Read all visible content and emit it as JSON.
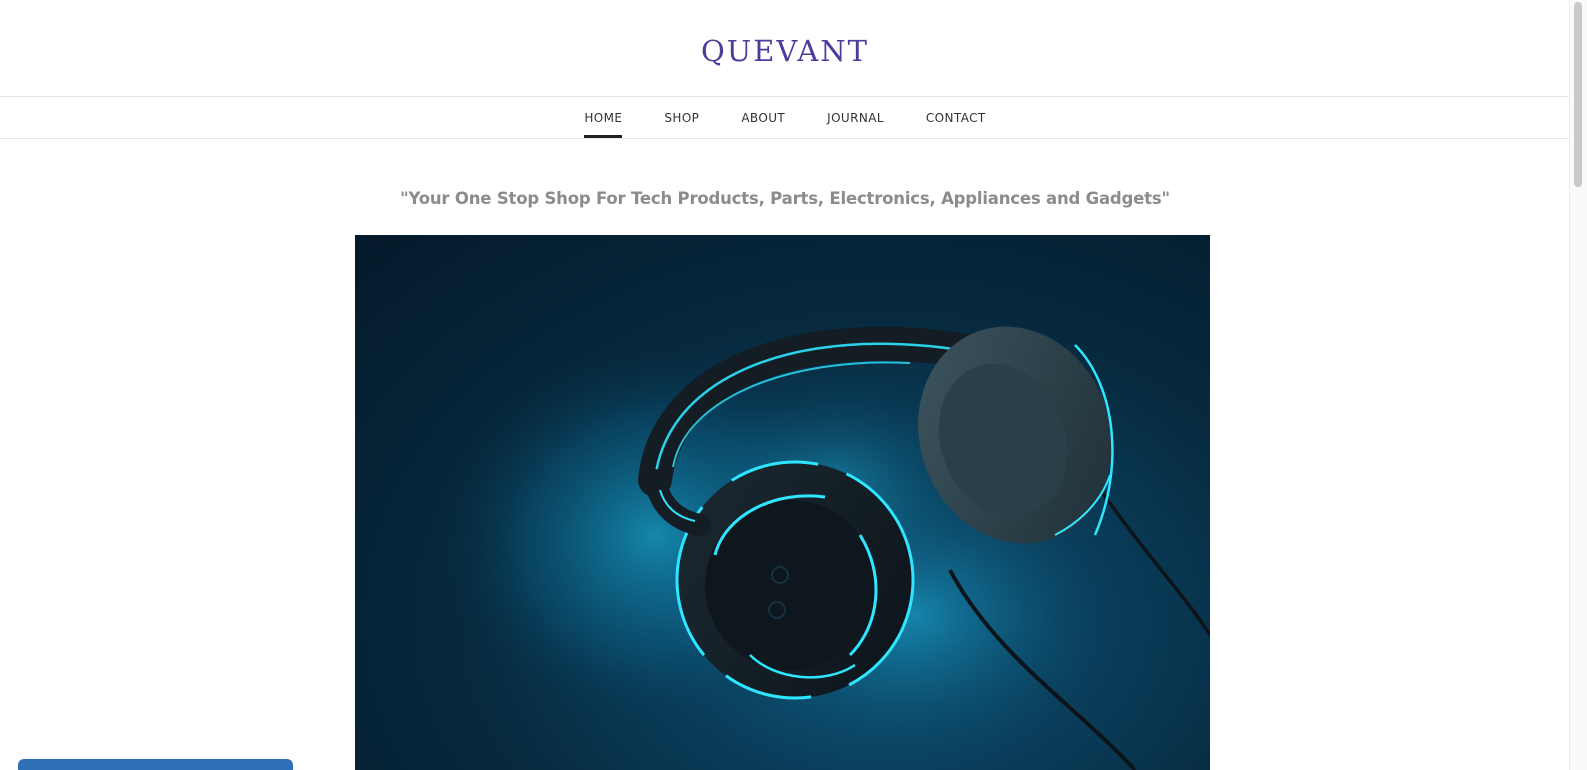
{
  "site": {
    "logo": "QUEVANT"
  },
  "nav": {
    "items": [
      {
        "label": "HOME",
        "active": true
      },
      {
        "label": "SHOP",
        "active": false
      },
      {
        "label": "ABOUT",
        "active": false
      },
      {
        "label": "JOURNAL",
        "active": false
      },
      {
        "label": "CONTACT",
        "active": false
      }
    ]
  },
  "main": {
    "tagline": "\"Your One Stop Shop For Tech Products, Parts, Electronics, Appliances and Gadgets\"",
    "hero_image": "headphones-neon-image"
  },
  "colors": {
    "logo": "#4a3e9c",
    "accent_glow": "#2ee6ff",
    "chat_widget": "#2f6fb8"
  }
}
